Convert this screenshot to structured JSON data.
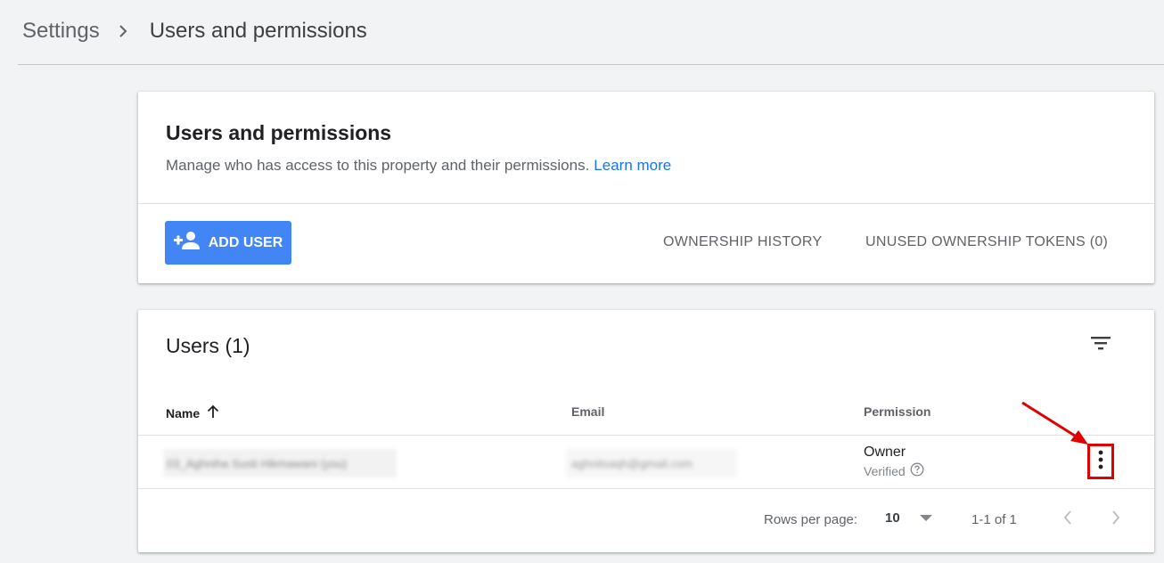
{
  "breadcrumb": {
    "root": "Settings",
    "current": "Users and permissions"
  },
  "header_card": {
    "title": "Users and permissions",
    "description": "Manage who has access to this property and their permissions.",
    "learn_more": "Learn more",
    "add_user_label": "ADD USER",
    "ownership_history_label": "OWNERSHIP HISTORY",
    "unused_tokens_label": "UNUSED OWNERSHIP TOKENS (0)"
  },
  "users_card": {
    "title": "Users (1)",
    "columns": {
      "name": "Name",
      "email": "Email",
      "permission": "Permission"
    },
    "rows": [
      {
        "name": "03_Aghniha Susti Hikmawani (you)",
        "email": "aghnitsaqh@gmail.com",
        "permission": "Owner",
        "status": "Verified"
      }
    ],
    "pagination": {
      "rows_per_page_label": "Rows per page:",
      "rows_per_page_value": "10",
      "range": "1-1 of 1"
    }
  },
  "colors": {
    "accent": "#4285f4",
    "link": "#1a73e8",
    "highlight": "#e00000"
  },
  "icons": {
    "breadcrumb_separator": "chevron-right-icon",
    "add_user": "person-add-icon",
    "filter": "filter-icon",
    "sort": "arrow-up-icon",
    "help": "help-circle-icon",
    "more": "more-vert-icon",
    "dropdown": "caret-down-icon",
    "prev": "chevron-left-icon",
    "next": "chevron-right-icon"
  }
}
